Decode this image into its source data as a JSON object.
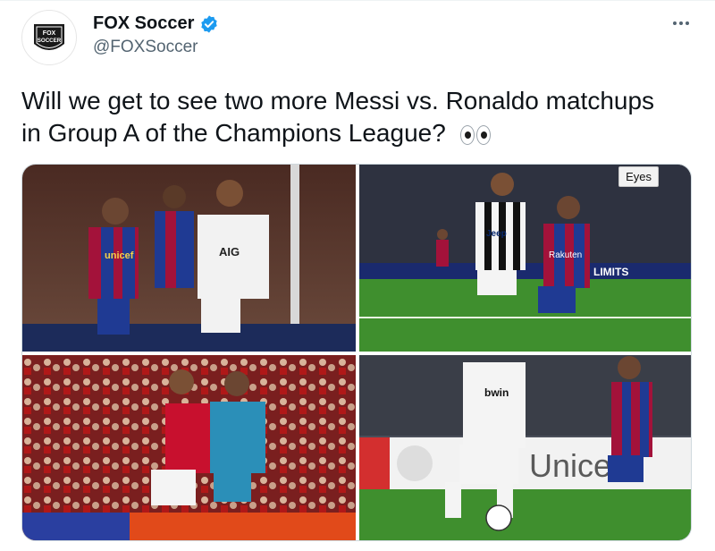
{
  "author": {
    "display_name": "FOX Soccer",
    "handle": "@FOXSoccer",
    "avatar_text_top": "FOX",
    "avatar_text_bottom": "SOCCER",
    "verified": true
  },
  "tweet": {
    "text": "Will we get to see two more Messi vs. Ronaldo matchups in Group A of the Champions League?",
    "emoji": "eyes-emoji"
  },
  "media": [
    {
      "name": "photo-1",
      "alt_badge": ""
    },
    {
      "name": "photo-2",
      "alt_badge": "Eyes"
    },
    {
      "name": "photo-3",
      "alt_badge": ""
    },
    {
      "name": "photo-4",
      "alt_badge": ""
    }
  ],
  "photo_text": {
    "p1_sponsor_left": "unicef",
    "p1_sponsor_right": "AIG",
    "p2_sponsor_left": "Jeep",
    "p2_sponsor_right": "Rakuten",
    "p2_board": "LIMITS",
    "p4_sponsor": "bwin",
    "p4_board": "Unicef"
  },
  "colors": {
    "verified": "#1d9bf0",
    "handle": "#536471",
    "barca_blue": "#1f3a93",
    "barca_red": "#a3123a",
    "pitch": "#3f8f2e",
    "united_red": "#c8102e"
  }
}
